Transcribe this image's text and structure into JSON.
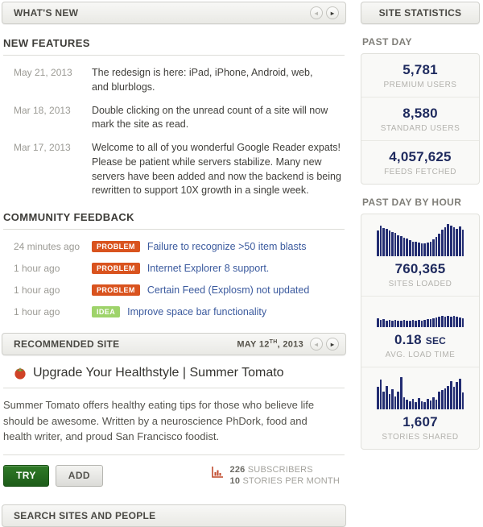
{
  "left": {
    "whats_new_title": "WHAT'S NEW",
    "new_features": {
      "heading": "NEW FEATURES",
      "entries": [
        {
          "date": "May 21, 2013",
          "text": "The redesign is here: iPad, iPhone, Android, web, and blurblogs."
        },
        {
          "date": "Mar 18, 2013",
          "text": "Double clicking on the unread count of a site will now mark the site as read."
        },
        {
          "date": "Mar 17, 2013",
          "text": "Welcome to all of you wonderful Google Reader expats! Please be patient while servers stabilize. Many new servers have been added and now the backend is being rewritten to support 10X growth in a single week."
        }
      ]
    },
    "community_feedback": {
      "heading": "COMMUNITY FEEDBACK",
      "items": [
        {
          "time": "24 minutes ago",
          "badge": "PROBLEM",
          "title": "Failure to recognize >50 item blasts"
        },
        {
          "time": "1 hour ago",
          "badge": "PROBLEM",
          "title": "Internet Explorer 8 support."
        },
        {
          "time": "1 hour ago",
          "badge": "PROBLEM",
          "title": "Certain Feed (Explosm) not updated"
        },
        {
          "time": "1 hour ago",
          "badge": "IDEA",
          "title": "Improve space bar functionality"
        }
      ]
    },
    "recommended": {
      "heading": "RECOMMENDED SITE",
      "date_prefix": "MAY 12",
      "date_sup": "TH",
      "date_suffix": ", 2013",
      "site_title": "Upgrade Your Healthstyle | Summer Tomato",
      "description": "Summer Tomato offers healthy eating tips for those who believe life should be awesome. Written by a neuroscience PhDork, food and health writer, and proud San Francisco foodist.",
      "try_label": "TRY",
      "add_label": "ADD",
      "subscribers_count": "226",
      "subscribers_label": "SUBSCRIBERS",
      "stories_count": "10",
      "stories_label": "STORIES PER MONTH"
    },
    "search_heading": "SEARCH SITES AND PEOPLE"
  },
  "right": {
    "header": "SITE STATISTICS",
    "past_day": {
      "heading": "PAST DAY",
      "stats": [
        {
          "value": "5,781",
          "label": "PREMIUM USERS"
        },
        {
          "value": "8,580",
          "label": "STANDARD USERS"
        },
        {
          "value": "4,057,625",
          "label": "FEEDS FETCHED"
        }
      ]
    },
    "past_day_by_hour": {
      "heading": "PAST DAY BY HOUR",
      "stats": [
        {
          "value": "760,365",
          "label": "SITES LOADED"
        },
        {
          "value": "0.18",
          "unit": "SEC",
          "label": "AVG. LOAD TIME"
        },
        {
          "value": "1,607",
          "label": "STORIES SHARED"
        }
      ]
    }
  },
  "colors": {
    "problem_badge": "#d9531e",
    "idea_badge": "#9ed36a",
    "link_blue": "#3b5a9e",
    "stat_number_navy": "#1e2a5e",
    "chart_bar_navy": "#232d72",
    "try_button_green": "#1d5c19",
    "subscriber_icon_red": "#c04a2c"
  },
  "chart_data": [
    {
      "type": "bar",
      "title": "Sites loaded, past day by hour",
      "note": "values are normalized bar heights 0-1, 30 hourly bars",
      "values": [
        0.8,
        0.95,
        0.88,
        0.84,
        0.8,
        0.76,
        0.72,
        0.66,
        0.62,
        0.58,
        0.54,
        0.5,
        0.46,
        0.44,
        0.42,
        0.4,
        0.4,
        0.42,
        0.46,
        0.52,
        0.6,
        0.7,
        0.82,
        0.9,
        1.0,
        0.94,
        0.9,
        0.86,
        0.92,
        0.82
      ]
    },
    {
      "type": "bar",
      "title": "Avg. load time, past day by hour",
      "note": "values are normalized bar heights 0-1, 30 hourly bars",
      "values": [
        0.42,
        0.34,
        0.38,
        0.32,
        0.34,
        0.32,
        0.34,
        0.3,
        0.32,
        0.34,
        0.3,
        0.32,
        0.34,
        0.3,
        0.34,
        0.32,
        0.34,
        0.38,
        0.4,
        0.44,
        0.46,
        0.5,
        0.52,
        0.5,
        0.52,
        0.5,
        0.52,
        0.5,
        0.46,
        0.44
      ]
    },
    {
      "type": "bar",
      "title": "Stories shared, past day by hour",
      "note": "values are normalized bar heights 0-1, 30 hourly bars",
      "values": [
        0.7,
        0.92,
        0.55,
        0.72,
        0.48,
        0.62,
        0.4,
        0.55,
        1.0,
        0.38,
        0.3,
        0.26,
        0.32,
        0.22,
        0.36,
        0.26,
        0.22,
        0.32,
        0.28,
        0.38,
        0.3,
        0.55,
        0.6,
        0.66,
        0.72,
        0.88,
        0.7,
        0.85,
        0.95,
        0.52
      ]
    }
  ]
}
